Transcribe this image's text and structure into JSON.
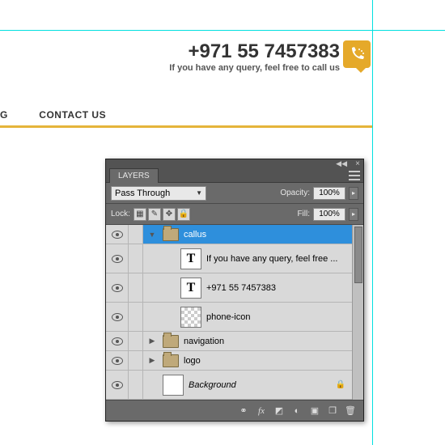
{
  "header": {
    "phone": "+971 55 7457383",
    "tagline": "If you have any query, feel free to call us"
  },
  "nav": {
    "items": [
      "G",
      "CONTACT US"
    ]
  },
  "panel": {
    "title": "LAYERS",
    "blend_mode": "Pass Through",
    "opacity_label": "Opacity:",
    "opacity_value": "100%",
    "lock_label": "Lock:",
    "fill_label": "Fill:",
    "fill_value": "100%",
    "layers": [
      {
        "name": "callus",
        "type": "group",
        "selected": true,
        "expanded": true,
        "indent": 0
      },
      {
        "name": "If you have any query, feel free ...",
        "type": "text",
        "indent": 1
      },
      {
        "name": "+971 55 7457383",
        "type": "text",
        "indent": 1
      },
      {
        "name": "phone-icon",
        "type": "raster",
        "indent": 1
      },
      {
        "name": "navigation",
        "type": "group",
        "expanded": false,
        "indent": 0
      },
      {
        "name": "logo",
        "type": "group",
        "expanded": false,
        "indent": 0
      },
      {
        "name": "Background",
        "type": "background",
        "locked": true,
        "indent": 0
      }
    ]
  }
}
